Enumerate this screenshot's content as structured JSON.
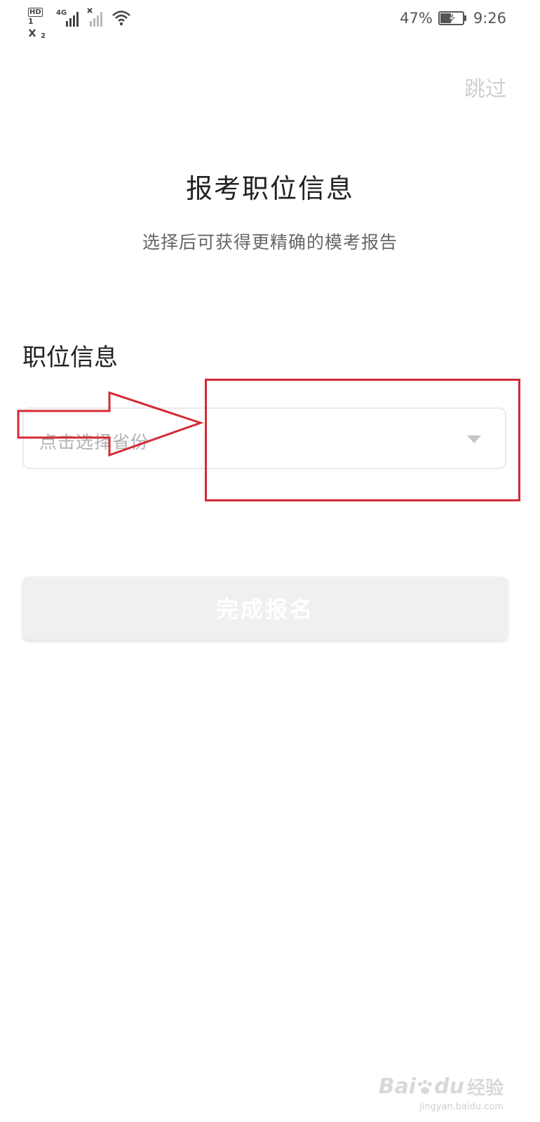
{
  "status_bar": {
    "hd_label": "HD",
    "sim1": "1",
    "sim2": "2",
    "network": "4G",
    "battery_percent": "47%",
    "battery_level": 0.47,
    "time": "9:26",
    "icons": [
      "hd-call-icon",
      "signal-icon",
      "no-signal-icon",
      "wifi-icon",
      "battery-charging-icon"
    ]
  },
  "header": {
    "skip_label": "跳过",
    "title": "报考职位信息",
    "subtitle": "选择后可获得更精确的模考报告"
  },
  "form": {
    "section_label": "职位信息",
    "province_select": {
      "placeholder": "点击选择省份",
      "icon": "caret-down-icon"
    },
    "submit_label": "完成报名"
  },
  "annotation": {
    "color": "#d42a36"
  },
  "watermark": {
    "brand": "Bai",
    "brand_tail": "du",
    "cn": "经验",
    "url": "jingyan.baidu.com"
  },
  "colors": {
    "button_disabled": "#f0f0f0",
    "skip_text": "#cfcfcf"
  }
}
